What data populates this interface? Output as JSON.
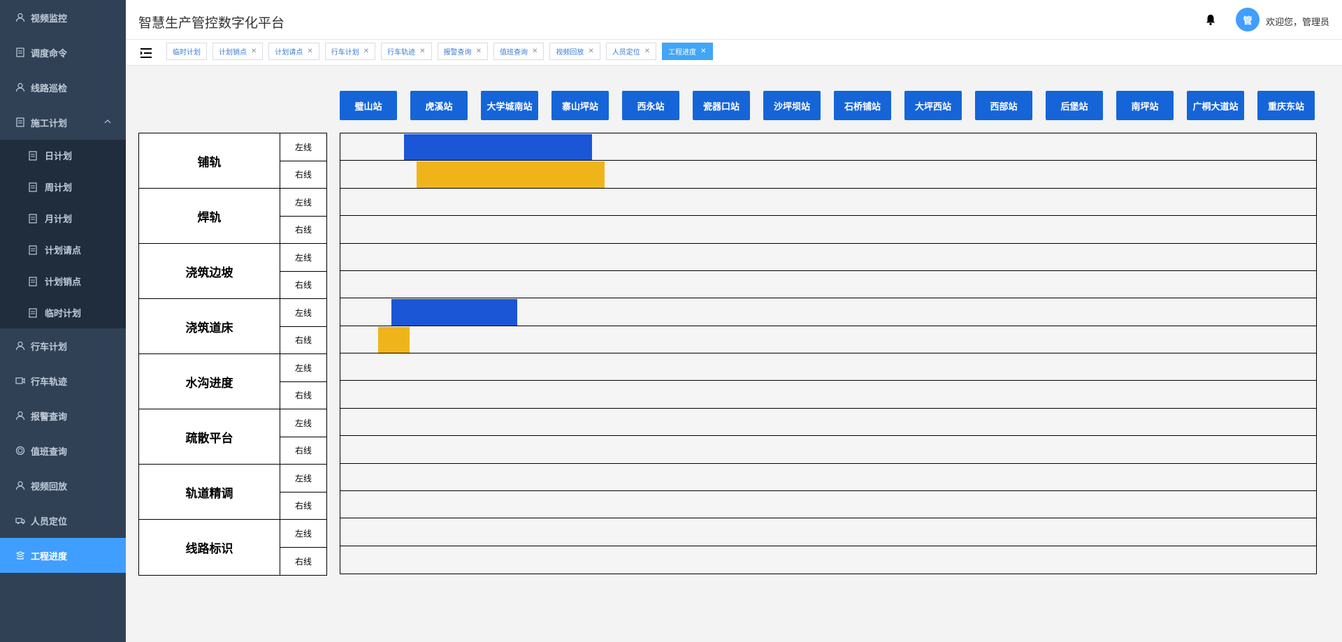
{
  "sidebar": {
    "items": [
      {
        "label": "视频监控",
        "icon": "user-icon"
      },
      {
        "label": "调度命令",
        "icon": "document-icon"
      },
      {
        "label": "线路巡检",
        "icon": "user-icon"
      },
      {
        "label": "施工计划",
        "icon": "document-icon",
        "expanded": true,
        "children": [
          {
            "label": "日计划"
          },
          {
            "label": "周计划"
          },
          {
            "label": "月计划"
          },
          {
            "label": "计划请点"
          },
          {
            "label": "计划销点"
          },
          {
            "label": "临时计划"
          }
        ]
      },
      {
        "label": "行车计划",
        "icon": "user-icon"
      },
      {
        "label": "行车轨迹",
        "icon": "video-icon"
      },
      {
        "label": "报警查询",
        "icon": "user-icon"
      },
      {
        "label": "值班查询",
        "icon": "circle-icon"
      },
      {
        "label": "视频回放",
        "icon": "user-icon"
      },
      {
        "label": "人员定位",
        "icon": "truck-icon"
      },
      {
        "label": "工程进度",
        "icon": "layers-icon",
        "active": true
      }
    ]
  },
  "header": {
    "title": "智慧生产管控数字化平台",
    "avatar_text": "管",
    "welcome": "欢迎您，管理员"
  },
  "tags": [
    {
      "label": "临时计划",
      "closable": false
    },
    {
      "label": "计划销点",
      "closable": true
    },
    {
      "label": "计划请点",
      "closable": true
    },
    {
      "label": "行车计划",
      "closable": true
    },
    {
      "label": "行车轨迹",
      "closable": true
    },
    {
      "label": "报警查询",
      "closable": true
    },
    {
      "label": "值班查询",
      "closable": true
    },
    {
      "label": "视频回放",
      "closable": true
    },
    {
      "label": "人员定位",
      "closable": true
    },
    {
      "label": "工程进度",
      "closable": true,
      "active": true
    }
  ],
  "stations": [
    "璧山站",
    "虎溪站",
    "大学城南站",
    "寨山坪站",
    "西永站",
    "瓷器口站",
    "沙坪坝站",
    "石桥铺站",
    "大坪西站",
    "西部站",
    "后堡站",
    "南坪站",
    "广桐大道站",
    "重庆东站"
  ],
  "categories": [
    {
      "name": "铺轨",
      "left_label": "左线",
      "right_label": "右线"
    },
    {
      "name": "焊轨",
      "left_label": "左线",
      "right_label": "右线"
    },
    {
      "name": "浇筑边坡",
      "left_label": "左线",
      "right_label": "右线"
    },
    {
      "name": "浇筑道床",
      "left_label": "左线",
      "right_label": "右线"
    },
    {
      "name": "水沟进度",
      "left_label": "左线",
      "right_label": "右线"
    },
    {
      "name": "疏散平台",
      "left_label": "左线",
      "right_label": "右线"
    },
    {
      "name": "轨道精调",
      "left_label": "左线",
      "right_label": "右线"
    },
    {
      "name": "线路标识",
      "left_label": "左线",
      "right_label": "右线"
    }
  ],
  "colors": {
    "left_line": "#1a56d6",
    "right_line": "#f0b41b",
    "active": "#409eff"
  },
  "progress": [
    {
      "category": "铺轨",
      "line": "左线",
      "start": 0.065,
      "end": 0.258
    },
    {
      "category": "铺轨",
      "line": "右线",
      "start": 0.078,
      "end": 0.271
    },
    {
      "category": "浇筑道床",
      "line": "左线",
      "start": 0.052,
      "end": 0.181
    },
    {
      "category": "浇筑道床",
      "line": "右线",
      "start": 0.039,
      "end": 0.071
    }
  ]
}
